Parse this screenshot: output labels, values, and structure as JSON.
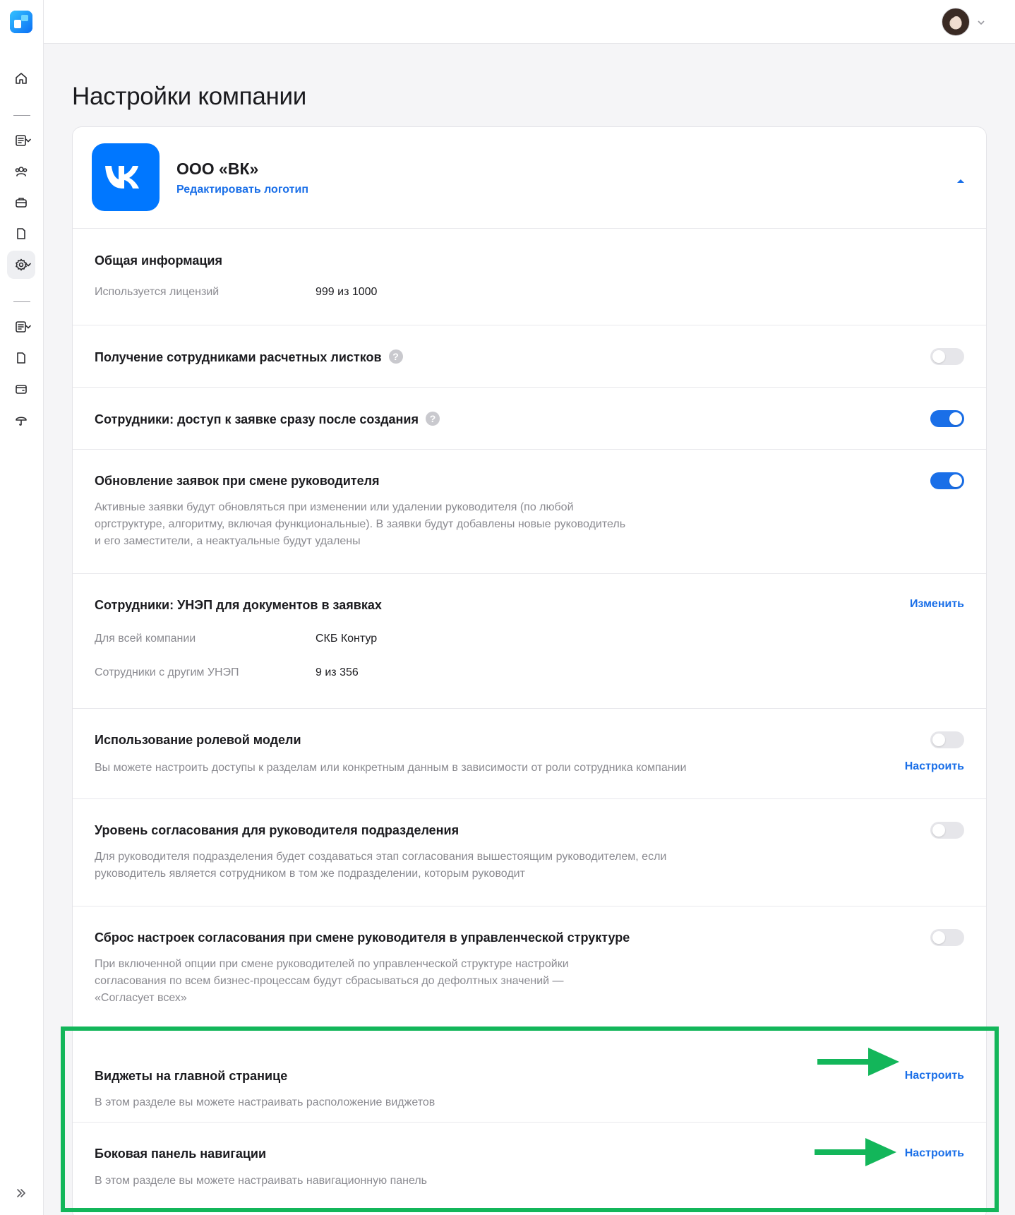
{
  "sidebar": {
    "icons": [
      "home-icon",
      "document-list-icon",
      "people-icon",
      "briefcase-icon",
      "file-icon",
      "gear-icon",
      "document-list-icon",
      "file-icon",
      "wallet-icon",
      "umbrella-icon"
    ],
    "expand_icon": "double-chevron-right-icon"
  },
  "header": {
    "avatar_icon": "user-avatar"
  },
  "page": {
    "title": "Настройки компании"
  },
  "company": {
    "name": "ООО «ВК»",
    "edit_logo": "Редактировать логотип",
    "logo_text": "VK",
    "brand_color": "#0077ff"
  },
  "general": {
    "title": "Общая информация",
    "licenses_label": "Используется лицензий",
    "licenses_value": "999 из 1000"
  },
  "payslips": {
    "title": "Получение сотрудниками расчетных листков",
    "help": "?",
    "enabled": false
  },
  "request_access": {
    "title": "Сотрудники: доступ к заявке сразу после создания",
    "help": "?",
    "enabled": true
  },
  "manager_update": {
    "title": "Обновление заявок при смене руководителя",
    "desc_1": "Активные заявки будут обновляться при изменении или удалении руководителя (по любой",
    "desc_2": "оргструктуре, алгоритму, включая функциональные). В заявки будут добавлены новые руководитель",
    "desc_3": "и его заместители, а неактуальные будут удалены",
    "enabled": true
  },
  "unep": {
    "title": "Сотрудники: УНЭП для документов в заявках",
    "action": "Изменить",
    "company_label": "Для всей компании",
    "company_value": "СКБ Контур",
    "others_label": "Сотрудники с другим УНЭП",
    "others_value": "9 из 356"
  },
  "roles": {
    "title": "Использование ролевой модели",
    "desc": "Вы можете настроить доступы к разделам или конкретным данным в зависимости от роли сотрудника компании",
    "action": "Настроить",
    "enabled": false
  },
  "approval_level": {
    "title": "Уровень согласования для руководителя подразделения",
    "desc_1": "Для руководителя подразделения будет создаваться этап согласования вышестоящим руководителем, если",
    "desc_2": "руководитель является сотрудником в том же подразделении, которым руководит",
    "enabled": false
  },
  "approval_reset": {
    "title": "Сброс настроек согласования при смене руководителя в управленческой структуре",
    "desc_1": "При включенной опции при смене руководителей по управленческой структуре настройки",
    "desc_2": "согласования по всем бизнес-процессам будут сбрасываться до дефолтных значений —",
    "desc_3": "«Согласует всех»",
    "enabled": false
  },
  "widgets": {
    "title": "Виджеты на главной странице",
    "desc": "В этом разделе вы можете настраивать расположение виджетов",
    "action": "Настроить"
  },
  "navigation": {
    "title": "Боковая панель навигации",
    "desc": "В этом разделе вы можете настраивать навигационную панель",
    "action": "Настроить"
  },
  "colors": {
    "accent": "#1a6fe8",
    "highlight": "#13b65a"
  }
}
